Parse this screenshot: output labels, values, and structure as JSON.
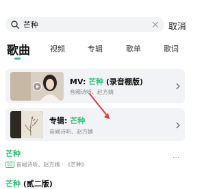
{
  "search": {
    "query": "芒种",
    "cancel_label": "取消"
  },
  "tabs": [
    {
      "label": "歌曲"
    },
    {
      "label": "视频"
    },
    {
      "label": "专辑"
    },
    {
      "label": "歌单"
    },
    {
      "label": "歌词"
    }
  ],
  "mv_card": {
    "title_prefix": "MV: ",
    "title_keyword": "芒种",
    "title_suffix": " (录音棚版)",
    "subtitle": "音阙诗听、赵方婧"
  },
  "album_card": {
    "title_prefix": "专辑: ",
    "title_keyword": "芒种",
    "subtitle": "音阙诗听、赵方婧"
  },
  "songs": [
    {
      "title": "芒种",
      "title_suffix": "",
      "badge": "SQ",
      "subtitle": "音阙诗听、赵方婧 · 《芒种》",
      "more": "···"
    },
    {
      "title": "芒种",
      "title_suffix": " (贰二版)"
    }
  ],
  "colors": {
    "accent": "#31c27c",
    "card_bg": "#f2f3f6",
    "annotation_arrow": "#e23b3b"
  }
}
